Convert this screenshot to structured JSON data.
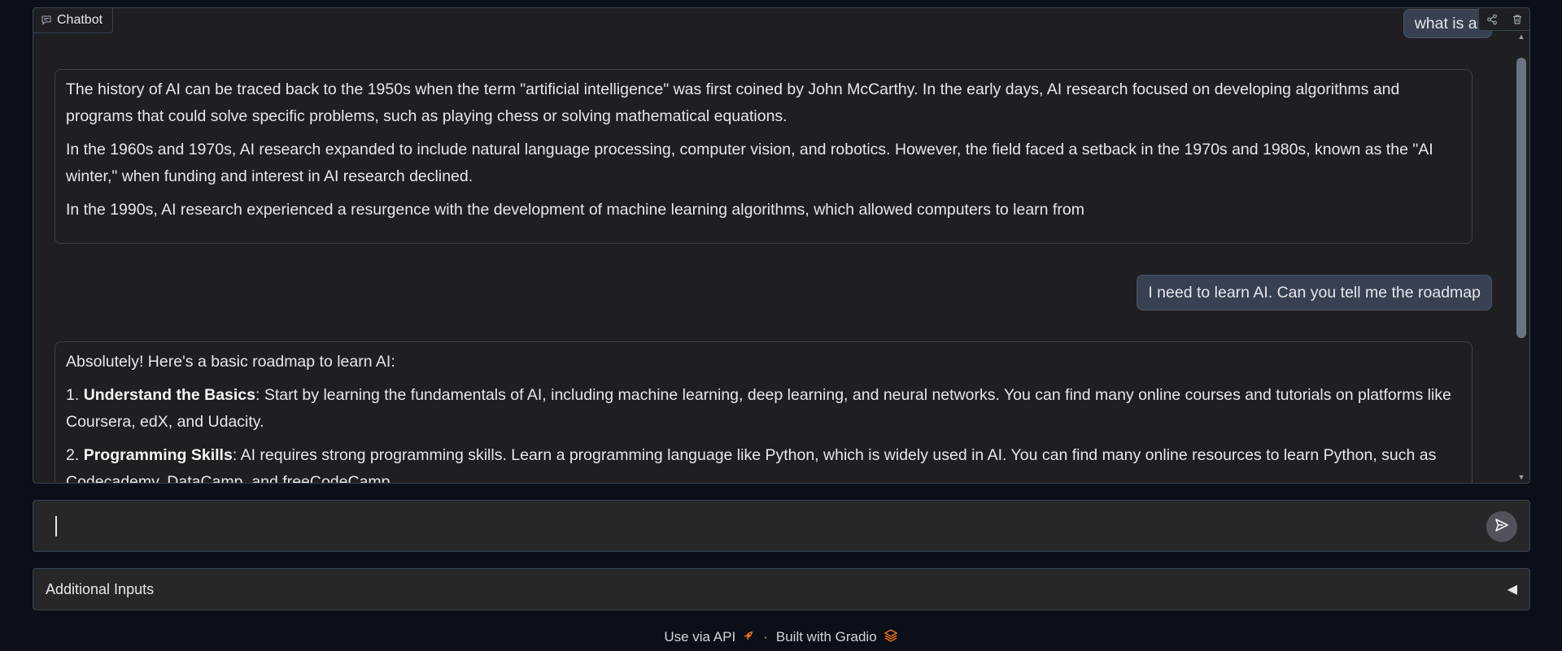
{
  "chatbot": {
    "label": "Chatbot",
    "label_icon": "chat-icon",
    "actions": [
      {
        "name": "share",
        "icon": "share-icon"
      },
      {
        "name": "delete",
        "icon": "trash-icon"
      }
    ],
    "messages": [
      {
        "role": "user",
        "text": "what is ai"
      },
      {
        "role": "bot",
        "paragraphs": [
          "The history of AI can be traced back to the 1950s when the term \"artificial intelligence\" was first coined by John McCarthy. In the early days, AI research focused on developing algorithms and programs that could solve specific problems, such as playing chess or solving mathematical equations.",
          "In the 1960s and 1970s, AI research expanded to include natural language processing, computer vision, and robotics. However, the field faced a setback in the 1970s and 1980s, known as the \"AI winter,\" when funding and interest in AI research declined.",
          "In the 1990s, AI research experienced a resurgence with the development of machine learning algorithms, which allowed computers to learn from"
        ]
      },
      {
        "role": "user",
        "text": "I need to learn AI. Can you tell me the roadmap"
      },
      {
        "role": "bot",
        "intro": "Absolutely! Here's a basic roadmap to learn AI:",
        "steps": [
          {
            "num": "1. ",
            "title": "Understand the Basics",
            "text": ": Start by learning the fundamentals of AI, including machine learning, deep learning, and neural networks. You can find many online courses and tutorials on platforms like Coursera, edX, and Udacity."
          },
          {
            "num": "2. ",
            "title": "Programming Skills",
            "text": ": AI requires strong programming skills. Learn a programming language like Python, which is widely used in AI. You can find many online resources to learn Python, such as Codecademy, DataCamp, and freeCodeCamp."
          }
        ]
      }
    ]
  },
  "input": {
    "value": "",
    "placeholder": "",
    "send_icon": "send-icon"
  },
  "accordion": {
    "label": "Additional Inputs",
    "icon": "triangle-left-icon"
  },
  "footer": {
    "api_label": "Use via API",
    "api_icon": "rocket-icon",
    "separator": "·",
    "built_label": "Built with Gradio",
    "gradio_icon": "gradio-logo-icon"
  },
  "colors": {
    "background": "#0b0f19",
    "panel": "#1f1f23",
    "user_bubble": "#374151",
    "border": "#374151",
    "text": "#e5e7eb",
    "gradio_orange": "#f97316"
  }
}
